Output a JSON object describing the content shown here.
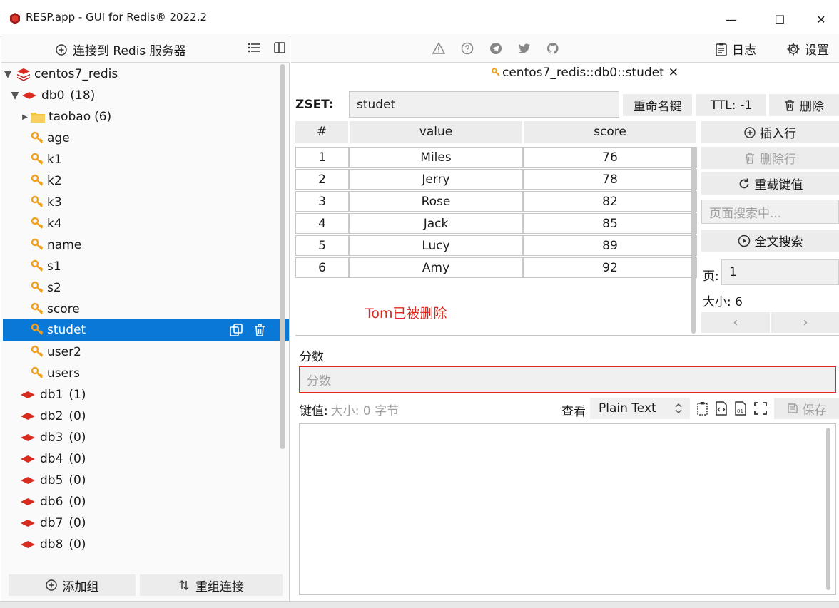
{
  "window": {
    "title": "RESP.app - GUI for Redis® 2022.2",
    "minimize": "—",
    "maximize": "☐",
    "close": "✕"
  },
  "left_panel": {
    "connect_label": "连接到 Redis 服务器",
    "connection_name": "centos7_redis",
    "db0": {
      "name": "db0",
      "count": "(18)"
    },
    "folder": {
      "name": "taobao",
      "count": "(6)"
    },
    "keys": [
      "age",
      "k1",
      "k2",
      "k3",
      "k4",
      "name",
      "s1",
      "s2",
      "score",
      "studet",
      "user2",
      "users"
    ],
    "selected_key": "studet",
    "databases": [
      {
        "name": "db1",
        "count": "(1)"
      },
      {
        "name": "db2",
        "count": "(0)"
      },
      {
        "name": "db3",
        "count": "(0)"
      },
      {
        "name": "db4",
        "count": "(0)"
      },
      {
        "name": "db5",
        "count": "(0)"
      },
      {
        "name": "db6",
        "count": "(0)"
      },
      {
        "name": "db7",
        "count": "(0)"
      },
      {
        "name": "db8",
        "count": "(0)"
      }
    ],
    "add_group_label": "添加组",
    "reconnect_label": "重组连接"
  },
  "toolbar": {
    "icons": [
      "warning-icon",
      "help-icon",
      "telegram-icon",
      "twitter-icon",
      "github-icon"
    ],
    "log_label": "日志",
    "settings_label": "设置"
  },
  "tab": {
    "label": "centos7_redis::db0::studet",
    "close": "✕"
  },
  "key_header": {
    "type_label": "ZSET:",
    "key_name": "studet",
    "rename_label": "重命名键",
    "ttl_label": "TTL:",
    "ttl_value": "-1",
    "delete_label": "删除"
  },
  "table": {
    "columns": [
      "#",
      "value",
      "score"
    ],
    "rows": [
      {
        "index": "1",
        "value": "Miles",
        "score": "76"
      },
      {
        "index": "2",
        "value": "Jerry",
        "score": "78"
      },
      {
        "index": "3",
        "value": "Rose",
        "score": "82"
      },
      {
        "index": "4",
        "value": "Jack",
        "score": "85"
      },
      {
        "index": "5",
        "value": "Lucy",
        "score": "89"
      },
      {
        "index": "6",
        "value": "Amy",
        "score": "92"
      }
    ],
    "note": "Tom已被删除"
  },
  "side_actions": {
    "insert_row": "插入行",
    "delete_row": "删除行",
    "reload": "重载键值",
    "page_search_placeholder": "页面搜索中...",
    "fulltext_search": "全文搜索",
    "page_label": "页:",
    "page_value": "1",
    "size_label": "大小:",
    "size_value": "6",
    "prev": "‹",
    "next": "›"
  },
  "editor": {
    "score_label": "分数",
    "score_placeholder": "分数",
    "value_label": "键值:",
    "value_size": "大小: 0 字节",
    "view_label": "查看",
    "format": "Plain Text",
    "save_label": "保存"
  },
  "colors": {
    "selection": "#0a78d7",
    "redis_red": "#d82c20",
    "key_orange": "#f0a01e",
    "folder_yellow": "#f5c542",
    "note_red": "#e0281e"
  }
}
